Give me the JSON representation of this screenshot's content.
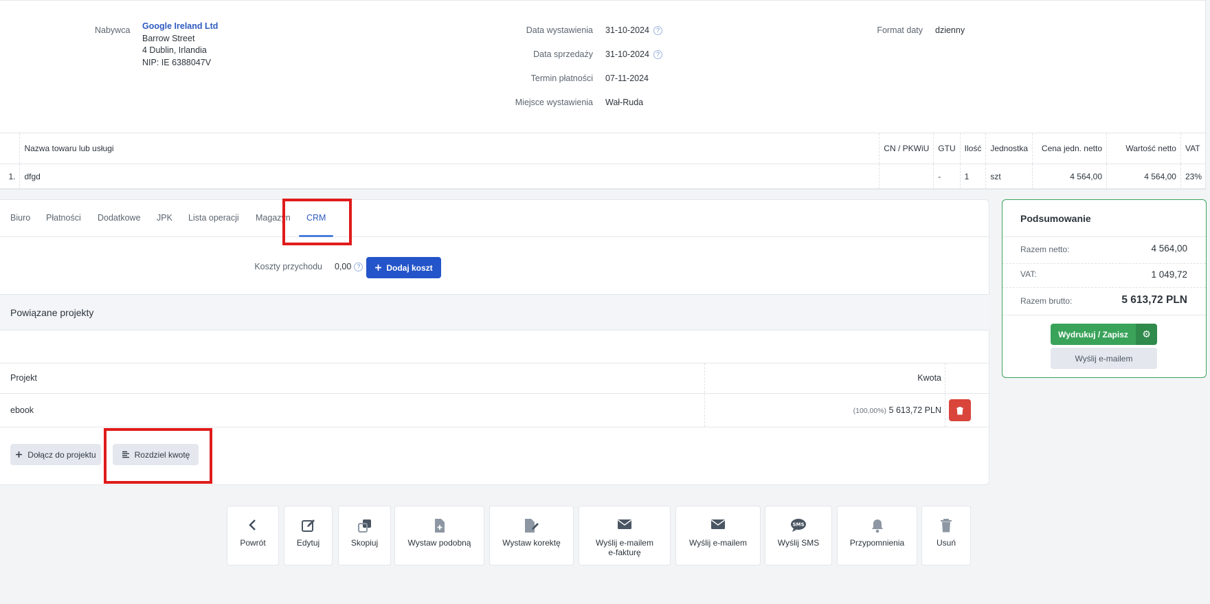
{
  "buyer": {
    "label": "Nabywca",
    "name": "Google Ireland Ltd",
    "street": "Barrow Street",
    "city": "4 Dublin, Irlandia",
    "tax_id": "NIP: IE 6388047V"
  },
  "dates": {
    "issue_label": "Data wystawienia",
    "issue_value": "31-10-2024",
    "sale_label": "Data sprzedaży",
    "sale_value": "31-10-2024",
    "due_label": "Termin płatności",
    "due_value": "07-11-2024",
    "place_label": "Miejsce wystawienia",
    "place_value": "Wał-Ruda"
  },
  "date_format": {
    "label": "Format daty",
    "value": "dzienny"
  },
  "items_table": {
    "headers": [
      "Nazwa towaru lub usługi",
      "CN / PKWiU",
      "GTU",
      "Ilość",
      "Jednostka",
      "Cena jedn.  netto",
      "Wartość netto",
      "VAT"
    ],
    "rows": [
      {
        "no": "1.",
        "name": "dfgd",
        "cn": "",
        "gtu": "-",
        "qty": "1",
        "unit": "szt",
        "unit_price": "4 564,00",
        "net_value": "4 564,00",
        "vat": "23%"
      }
    ]
  },
  "tabs": [
    "Biuro",
    "Płatności",
    "Dodatkowe",
    "JPK",
    "Lista operacji",
    "Magazyn",
    "CRM"
  ],
  "active_tab": "CRM",
  "costs": {
    "label": "Koszty przychodu",
    "value": "0,00",
    "add_button": "Dodaj koszt"
  },
  "projects": {
    "title": "Powiązane projekty",
    "col_project": "Projekt",
    "col_amount": "Kwota",
    "rows": [
      {
        "name": "ebook",
        "percent": "(100,00%)",
        "amount": "5 613,72 PLN"
      }
    ],
    "attach_button": "Dołącz do projektu",
    "split_button": "Rozdziel kwotę"
  },
  "summary": {
    "title": "Podsumowanie",
    "net_label": "Razem netto:",
    "net_value": "4 564,00",
    "vat_label": "VAT:",
    "vat_value": "1 049,72",
    "gross_label": "Razem brutto:",
    "gross_value": "5 613,72 PLN",
    "print_button": "Wydrukuj / Zapisz",
    "email_button": "Wyślij e-mailem"
  },
  "actions": {
    "back": "Powrót",
    "edit": "Edytuj",
    "copy": "Skopiuj",
    "similar": "Wystaw podobną",
    "correction": "Wystaw korektę",
    "einvoice_line1": "Wyślij e-mailem",
    "einvoice_line2": "e-fakturę",
    "email": "Wyślij e-mailem",
    "sms": "Wyślij SMS",
    "reminders": "Przypomnienia",
    "delete": "Usuń"
  },
  "icons": {
    "help": "question-circle-icon",
    "plus": "plus-icon",
    "trash": "trash-icon",
    "gear": "gear-icon",
    "split": "align-left-icon",
    "back": "chevron-left-icon",
    "edit": "pencil-icon",
    "copy": "copy-icon",
    "similar": "file-plus-icon",
    "correction": "file-edit-icon",
    "envelope": "envelope-icon",
    "sms": "sms-bubble-icon",
    "bell": "bell-icon"
  },
  "colors": {
    "accent": "#2454c9",
    "success": "#3aa35a",
    "danger": "#d9443b",
    "highlight": "#e01b1b"
  }
}
